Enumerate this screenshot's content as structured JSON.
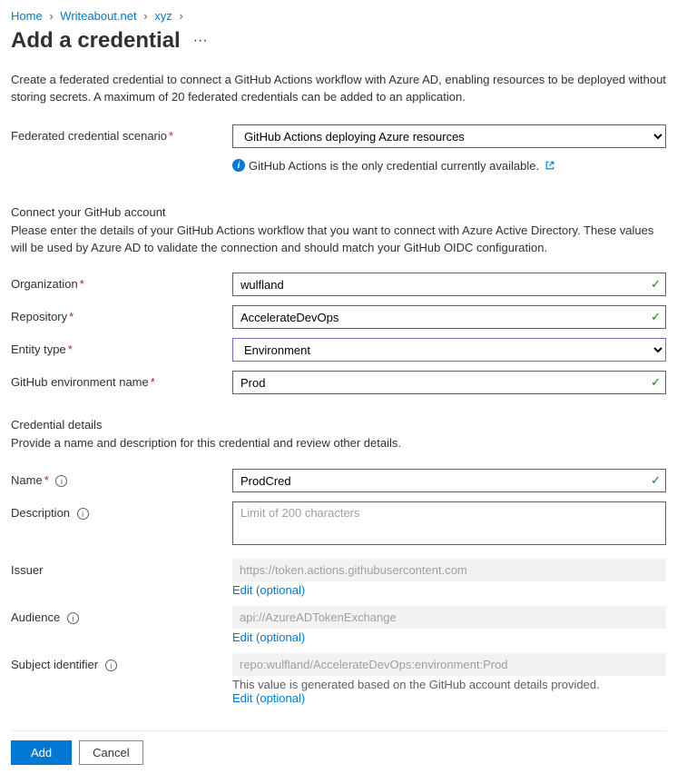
{
  "breadcrumb": {
    "home": "Home",
    "item2": "Writeabout.net",
    "item3": "xyz"
  },
  "page": {
    "title": "Add a credential",
    "ellipsis": "···"
  },
  "intro": "Create a federated credential to connect a GitHub Actions workflow with Azure AD, enabling resources to be deployed without storing secrets. A maximum of 20 federated credentials can be added to an application.",
  "scenario": {
    "label": "Federated credential scenario",
    "value": "GitHub Actions deploying Azure resources",
    "helper": "GitHub Actions is the only credential currently available."
  },
  "connect": {
    "heading": "Connect your GitHub account",
    "desc": "Please enter the details of your GitHub Actions workflow that you want to connect with Azure Active Directory. These values will be used by Azure AD to validate the connection and should match your GitHub OIDC configuration."
  },
  "org": {
    "label": "Organization",
    "value": "wulfland"
  },
  "repo": {
    "label": "Repository",
    "value": "AccelerateDevOps"
  },
  "entity": {
    "label": "Entity type",
    "value": "Environment"
  },
  "envname": {
    "label": "GitHub environment name",
    "value": "Prod"
  },
  "details": {
    "heading": "Credential details",
    "desc": "Provide a name and description for this credential and review other details."
  },
  "name": {
    "label": "Name",
    "value": "ProdCred"
  },
  "description": {
    "label": "Description",
    "placeholder": "Limit of 200 characters"
  },
  "issuer": {
    "label": "Issuer",
    "value": "https://token.actions.githubusercontent.com",
    "edit": "Edit (optional)"
  },
  "audience": {
    "label": "Audience",
    "value": "api://AzureADTokenExchange",
    "edit": "Edit (optional)"
  },
  "subject": {
    "label": "Subject identifier",
    "value": "repo:wulfland/AccelerateDevOps:environment:Prod",
    "helper": "This value is generated based on the GitHub account details provided.",
    "edit": "Edit (optional)"
  },
  "footer": {
    "add": "Add",
    "cancel": "Cancel"
  }
}
